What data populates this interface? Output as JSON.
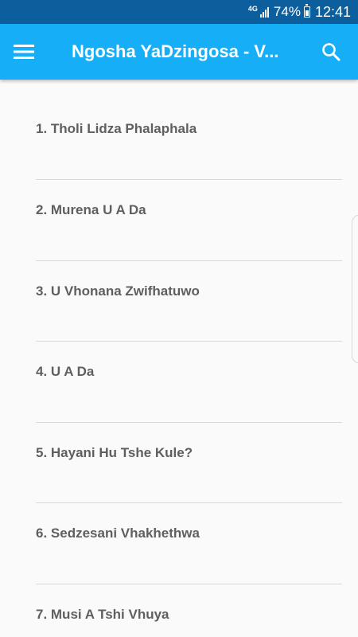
{
  "status_bar": {
    "network": "4G",
    "battery": "74%",
    "time": "12:41"
  },
  "app_bar": {
    "title": "Ngosha YaDzingosa - V..."
  },
  "list": {
    "items": [
      "1. Tholi Lidza Phalaphala",
      "2. Murena U A Da",
      "3. U Vhonana Zwifhatuwo",
      "4. U A Da",
      "5. Hayani Hu Tshe Kule?",
      "6. Sedzesani Vhakhethwa",
      "7. Musi A Tshi Vhuya"
    ]
  },
  "colors": {
    "status_bar": "#0d5e9c",
    "app_bar": "#16aef6",
    "background": "#fafafa",
    "item_text": "#5f5f5f"
  },
  "icons": {
    "menu": "hamburger-menu-icon",
    "search": "search-icon"
  }
}
